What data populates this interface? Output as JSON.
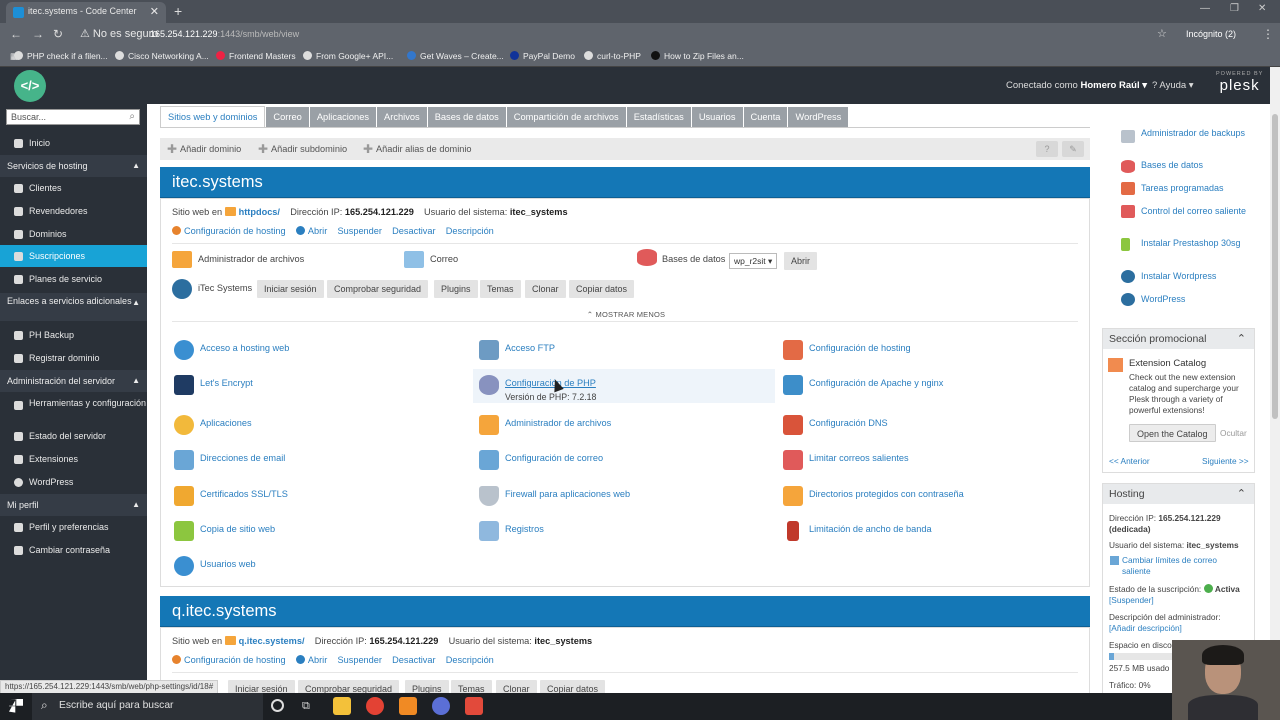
{
  "browser": {
    "tab_title": "itec.systems - Code Center",
    "security": "No es seguro",
    "url_host": "165.254.121.229",
    "url_rest": ":1443/smb/web/view",
    "profile": "Incógnito (2)",
    "bookmarks": [
      "PHP check if a filen...",
      "Cisco Networking A...",
      "Frontend Masters",
      "From Google+ API...",
      "Get Waves – Create...",
      "PayPal Demo",
      "curl-to-PHP",
      "How to Zip Files an..."
    ]
  },
  "header": {
    "connected_label": "Conectado como",
    "user": "Homero Raúl ▾",
    "help": "? Ayuda ▾",
    "powered_by": "POWERED BY",
    "brand": "plesk"
  },
  "sidebar": {
    "search_placeholder": "Buscar...",
    "items": [
      {
        "label": "Inicio"
      },
      {
        "section": "Servicios de hosting"
      },
      {
        "label": "Clientes"
      },
      {
        "label": "Revendedores"
      },
      {
        "label": "Dominios"
      },
      {
        "label": "Suscripciones"
      },
      {
        "label": "Planes de servicio"
      },
      {
        "section": "Enlaces a servicios adicionales"
      },
      {
        "label": "PH Backup"
      },
      {
        "label": "Registrar dominio"
      },
      {
        "section": "Administración del servidor"
      },
      {
        "label": "Herramientas y configuración"
      },
      {
        "label": "Estado del servidor"
      },
      {
        "label": "Extensiones"
      },
      {
        "label": "WordPress"
      },
      {
        "section": "Mi perfil"
      },
      {
        "label": "Perfil y preferencias"
      },
      {
        "label": "Cambiar contraseña"
      }
    ]
  },
  "tabs": [
    "Sitios web y dominios",
    "Correo",
    "Aplicaciones",
    "Archivos",
    "Bases de datos",
    "Compartición de archivos",
    "Estadísticas",
    "Usuarios",
    "Cuenta",
    "WordPress"
  ],
  "toolbar": [
    "Añadir dominio",
    "Añadir subdominio",
    "Añadir alias de dominio"
  ],
  "domain1": {
    "name": "itec.systems",
    "site_label": "Sitio web en",
    "site_link": "httpdocs/",
    "ip_label": "Dirección IP:",
    "ip": "165.254.121.229",
    "user_label": "Usuario del sistema:",
    "user": "itec_systems",
    "actions": [
      "Configuración de hosting",
      "Abrir",
      "Suspender",
      "Desactivar",
      "Descripción"
    ],
    "file_manager": "Administrador de archivos",
    "mail": "Correo",
    "databases": "Bases de datos",
    "db_select": "wp_r2sit ▾",
    "db_open": "Abrir",
    "wp_site": "iTec Systems",
    "wp_buttons": [
      "Iniciar sesión",
      "Comprobar seguridad",
      "Plugins",
      "Temas",
      "Clonar",
      "Copiar datos"
    ],
    "show_less": "⌃ MOSTRAR MENOS",
    "tools": [
      {
        "label": "Acceso a hosting web",
        "color": "#3a8fd1"
      },
      {
        "label": "Acceso FTP",
        "color": "#6d9bc3"
      },
      {
        "label": "Configuración de hosting",
        "color": "#e36a45"
      },
      {
        "label": "Let's Encrypt",
        "color": "#1f3b63"
      },
      {
        "label": "Configuración de PHP",
        "sub": "Versión de PHP: 7.2.18",
        "color": "#8892bf"
      },
      {
        "label": "Configuración de Apache y nginx",
        "color": "#3d8ec9"
      },
      {
        "label": "Aplicaciones",
        "color": "#f2b93b"
      },
      {
        "label": "Administrador de archivos",
        "color": "#f5a53b"
      },
      {
        "label": "Configuración DNS",
        "color": "#d9543a"
      },
      {
        "label": "Direcciones de email",
        "color": "#6aa6d6"
      },
      {
        "label": "Configuración de correo",
        "color": "#6aa6d6"
      },
      {
        "label": "Limitar correos salientes",
        "color": "#e05a5a"
      },
      {
        "label": "Certificados SSL/TLS",
        "color": "#f0a830"
      },
      {
        "label": "Firewall para aplicaciones web",
        "color": "#b9c2cc"
      },
      {
        "label": "Directorios protegidos con contraseña",
        "color": "#f5a53b"
      },
      {
        "label": "Copia de sitio web",
        "color": "#8cc63f"
      },
      {
        "label": "Registros",
        "color": "#8fb8de"
      },
      {
        "label": "Limitación de ancho de banda",
        "color": "#c0392b"
      },
      {
        "label": "Usuarios web",
        "color": "#3a8fd1"
      }
    ]
  },
  "domain2": {
    "name": "q.itec.systems",
    "site_label": "Sitio web en",
    "site_link": "q.itec.systems/",
    "ip_label": "Dirección IP:",
    "ip": "165.254.121.229",
    "user_label": "Usuario del sistema:",
    "user": "itec_systems",
    "actions": [
      "Configuración de hosting",
      "Abrir",
      "Suspender",
      "Desactivar",
      "Descripción"
    ],
    "wp_buttons": [
      "Iniciar sesión",
      "Comprobar seguridad",
      "Plugins",
      "Temas",
      "Clonar",
      "Copiar datos"
    ]
  },
  "right": {
    "links": [
      "Administrador de backups",
      "Bases de datos",
      "Tareas programadas",
      "Control del correo saliente",
      "Instalar Prestashop 30sg",
      "Instalar Wordpress",
      "WordPress"
    ],
    "promo_title": "Sección promocional",
    "promo_name": "Extension Catalog",
    "promo_text": "Check out the new extension catalog and supercharge your Plesk through a variety of powerful extensions!",
    "promo_button": "Open the Catalog",
    "promo_hide": "Ocultar",
    "prev": "<< Anterior",
    "next": "Siguiente >>",
    "hosting_title": "Hosting",
    "ip_line": "Dirección IP:",
    "ip_value": "165.254.121.229",
    "ip_type": "(dedicada)",
    "sys_user_label": "Usuario del sistema:",
    "sys_user": "itec_systems",
    "change_limits": "Cambiar límites de correo saliente",
    "sub_state_label": "Estado de la suscripción:",
    "sub_state": "Activa",
    "suspend": "[Suspender]",
    "admin_desc_label": "Descripción del administrador:",
    "admin_desc": "[Añadir descripción]",
    "disk_label": "Espacio en disco",
    "disk_used": "257.5 MB usado",
    "traffic": "Tráfico: 0%"
  },
  "statusbar": "https://165.254.121.229:1443/smb/web/php-settings/id/18#",
  "taskbar": {
    "search": "Escribe aquí para buscar"
  }
}
